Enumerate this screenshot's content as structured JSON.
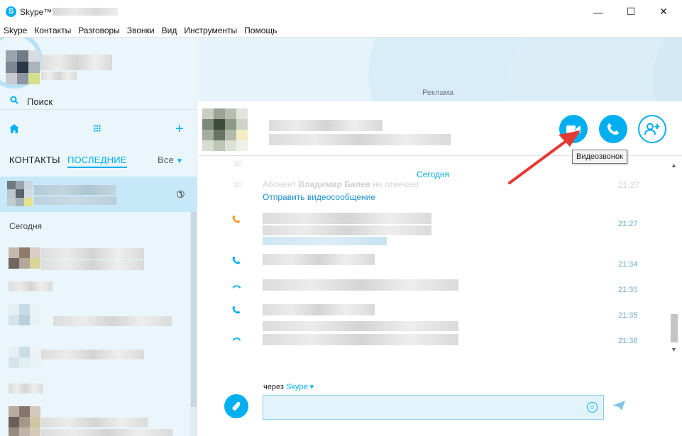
{
  "window": {
    "title": "Skype™ - ",
    "minimize": "—",
    "maximize": "☐",
    "close": "✕"
  },
  "menu": [
    "Skype",
    "Контакты",
    "Разговоры",
    "Звонки",
    "Вид",
    "Инструменты",
    "Помощь"
  ],
  "sidebar": {
    "search_label": "Поиск",
    "tabs": {
      "contacts": "КОНТАКТЫ",
      "recent": "ПОСЛЕДНИЕ",
      "filter": "Все"
    },
    "section_today": "Сегодня"
  },
  "ad": {
    "label": "Реклама"
  },
  "conversation": {
    "buttons": {
      "video": "video-call",
      "call": "audio-call",
      "add": "add-participant"
    },
    "tooltip": "Видеозвонок",
    "date_separator": "Сегодня",
    "missed_prefix": "Абонент",
    "missed_name": "Владимир Балев",
    "missed_suffix": "не отвечает.",
    "send_video_link": "Отправить видеосообщение",
    "times": [
      "21:27",
      "21:34",
      "21:35",
      "21:35",
      "21:38"
    ]
  },
  "composer": {
    "via_prefix": "через",
    "via_service": "Skype",
    "placeholder": ""
  },
  "colors": {
    "accent": "#00aff0",
    "missed": "#f39c1f",
    "annotation_arrow": "#e53935"
  }
}
